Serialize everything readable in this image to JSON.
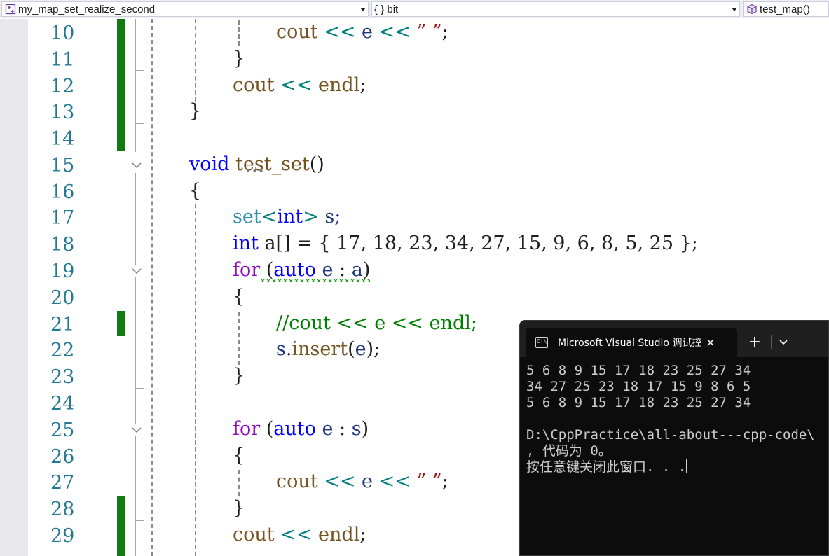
{
  "navbar": {
    "project": "my_map_set_realize_second",
    "scope": "{ } bit",
    "member": "test_map()"
  },
  "editor": {
    "line_numbers": [
      "10",
      "11",
      "12",
      "13",
      "14",
      "15",
      "16",
      "17",
      "18",
      "19",
      "20",
      "21",
      "22",
      "23",
      "24",
      "25",
      "26",
      "27",
      "28",
      "29"
    ],
    "lines": {
      "l10": {
        "a": "cout",
        "b": " << ",
        "c": "e",
        "d": " << ",
        "e": "” ”",
        "f": ";"
      },
      "l11": {
        "a": "}"
      },
      "l12": {
        "a": "cout",
        "b": " << ",
        "c": "endl",
        "d": ";"
      },
      "l13": {
        "a": "}"
      },
      "l15": {
        "a": "void",
        "b": " ",
        "c": "test_set",
        "d": "()"
      },
      "l16": {
        "a": "{"
      },
      "l17": {
        "a": "set",
        "b": "<",
        "c": "int",
        "d": ">",
        "e": " s;"
      },
      "l18": {
        "a": "int",
        "b": " a[] = { 17, 18, 23, 34, 27, 15, 9, 6, 8, 5, 25 };"
      },
      "l19": {
        "a": "for",
        "b": " (",
        "c": "auto",
        "d": " ",
        "e": "e",
        "f": " : ",
        "g": "a",
        "h": ")"
      },
      "l20": {
        "a": "{"
      },
      "l21": {
        "a": "//cout << e << endl;"
      },
      "l22": {
        "a": "s",
        "b": ".",
        "c": "insert",
        "d": "(",
        "e": "e",
        "f": ");"
      },
      "l23": {
        "a": "}"
      },
      "l25": {
        "a": "for",
        "b": " (",
        "c": "auto",
        "d": " ",
        "e": "e",
        "f": " : ",
        "g": "s",
        "h": ")"
      },
      "l26": {
        "a": "{"
      },
      "l27": {
        "a": "cout",
        "b": " << ",
        "c": "e",
        "d": " << ",
        "e": "” ”",
        "f": ";"
      },
      "l28": {
        "a": "}"
      },
      "l29": {
        "a": "cout",
        "b": " << ",
        "c": "endl",
        "d": ";"
      }
    }
  },
  "console": {
    "tab_title": "Microsoft Visual Studio 调试控",
    "close_glyph": "✕",
    "new_tab_glyph": "+",
    "output": [
      "5 6 8 9 15 17 18 23 25 27 34",
      "34 27 25 23 18 17 15 9 8 6 5",
      "5 6 8 9 15 17 18 23 25 27 34",
      "",
      "D:\\CppPractice\\all-about---cpp-code\\",
      ", 代码为 0。",
      "按任意键关闭此窗口. . ."
    ]
  },
  "colors": {
    "keyword": "#0000ff",
    "control": "#8f08c4",
    "type": "#2b91af",
    "function": "#74531f",
    "string": "#a31515",
    "comment": "#008000",
    "change_bar": "#107c10",
    "console_bg": "#0c0c0c"
  }
}
